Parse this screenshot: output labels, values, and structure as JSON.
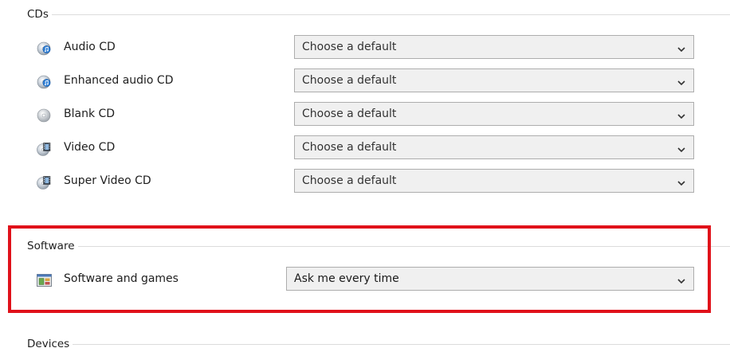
{
  "groups": {
    "cds": {
      "title": "CDs",
      "items": [
        {
          "label": "Audio CD",
          "icon": "audio-cd-icon",
          "value": "Choose a default"
        },
        {
          "label": "Enhanced audio CD",
          "icon": "enhanced-audio-cd-icon",
          "value": "Choose a default"
        },
        {
          "label": "Blank CD",
          "icon": "blank-cd-icon",
          "value": "Choose a default"
        },
        {
          "label": "Video CD",
          "icon": "video-cd-icon",
          "value": "Choose a default"
        },
        {
          "label": "Super Video CD",
          "icon": "super-video-cd-icon",
          "value": "Choose a default"
        }
      ]
    },
    "software": {
      "title": "Software",
      "items": [
        {
          "label": "Software and games",
          "icon": "software-games-icon",
          "value": "Ask me every time"
        }
      ]
    },
    "devices": {
      "title": "Devices"
    }
  },
  "colors": {
    "highlight": "#e0111a",
    "dropdown_bg": "#f0f0f0",
    "dropdown_border": "#adadad"
  }
}
